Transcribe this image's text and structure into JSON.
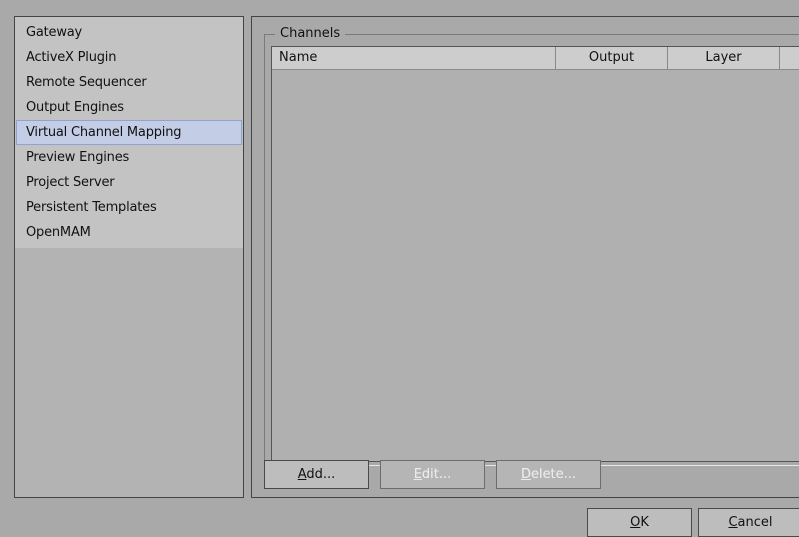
{
  "sidebar": {
    "items": [
      {
        "label": "Gateway"
      },
      {
        "label": "ActiveX Plugin"
      },
      {
        "label": "Remote Sequencer"
      },
      {
        "label": "Output Engines"
      },
      {
        "label": "Virtual Channel Mapping",
        "selected": true
      },
      {
        "label": "Preview Engines"
      },
      {
        "label": "Project Server"
      },
      {
        "label": "Persistent Templates"
      },
      {
        "label": "OpenMAM"
      }
    ]
  },
  "channels": {
    "group_title": "Channels",
    "columns": [
      "Name",
      "Output",
      "Layer"
    ],
    "rows": []
  },
  "actions": {
    "add": {
      "access_key": "A",
      "rest": "dd..."
    },
    "edit": {
      "access_key": "E",
      "rest": "dit..."
    },
    "delete": {
      "access_key": "D",
      "rest": "elete..."
    }
  },
  "dialog": {
    "ok": {
      "access_key": "O",
      "rest": "K"
    },
    "cancel": {
      "access_key": "C",
      "rest": "ancel"
    }
  },
  "colors": {
    "background": "#a9a9a9",
    "list_background": "#c3c3c3",
    "selected_item": "#c3cde6"
  }
}
